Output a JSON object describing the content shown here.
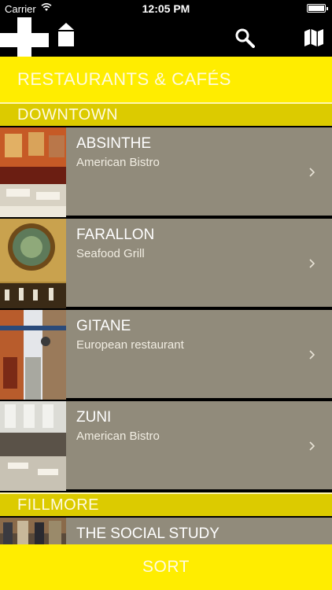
{
  "status_bar": {
    "carrier": "Carrier",
    "time": "12:05 PM"
  },
  "header": {
    "title": "RESTAURANTS & CAFÉS",
    "icons": [
      "plus-icon",
      "home-icon",
      "search-icon",
      "map-icon"
    ]
  },
  "sections": [
    {
      "name": "DOWNTOWN",
      "items": [
        {
          "name": "ABSINTHE",
          "cuisine": "American Bistro"
        },
        {
          "name": "FARALLON",
          "cuisine": "Seafood Grill"
        },
        {
          "name": "GITANE",
          "cuisine": "European restaurant"
        },
        {
          "name": "ZUNI",
          "cuisine": "American Bistro"
        }
      ]
    },
    {
      "name": "FILLMORE",
      "items": [
        {
          "name": "THE SOCIAL STUDY",
          "cuisine": ""
        }
      ]
    }
  ],
  "footer": {
    "sort_label": "SORT"
  },
  "colors": {
    "brand_yellow": "#ffed00",
    "section_yellow": "#dccb00",
    "row_taupe": "#918b7b"
  }
}
